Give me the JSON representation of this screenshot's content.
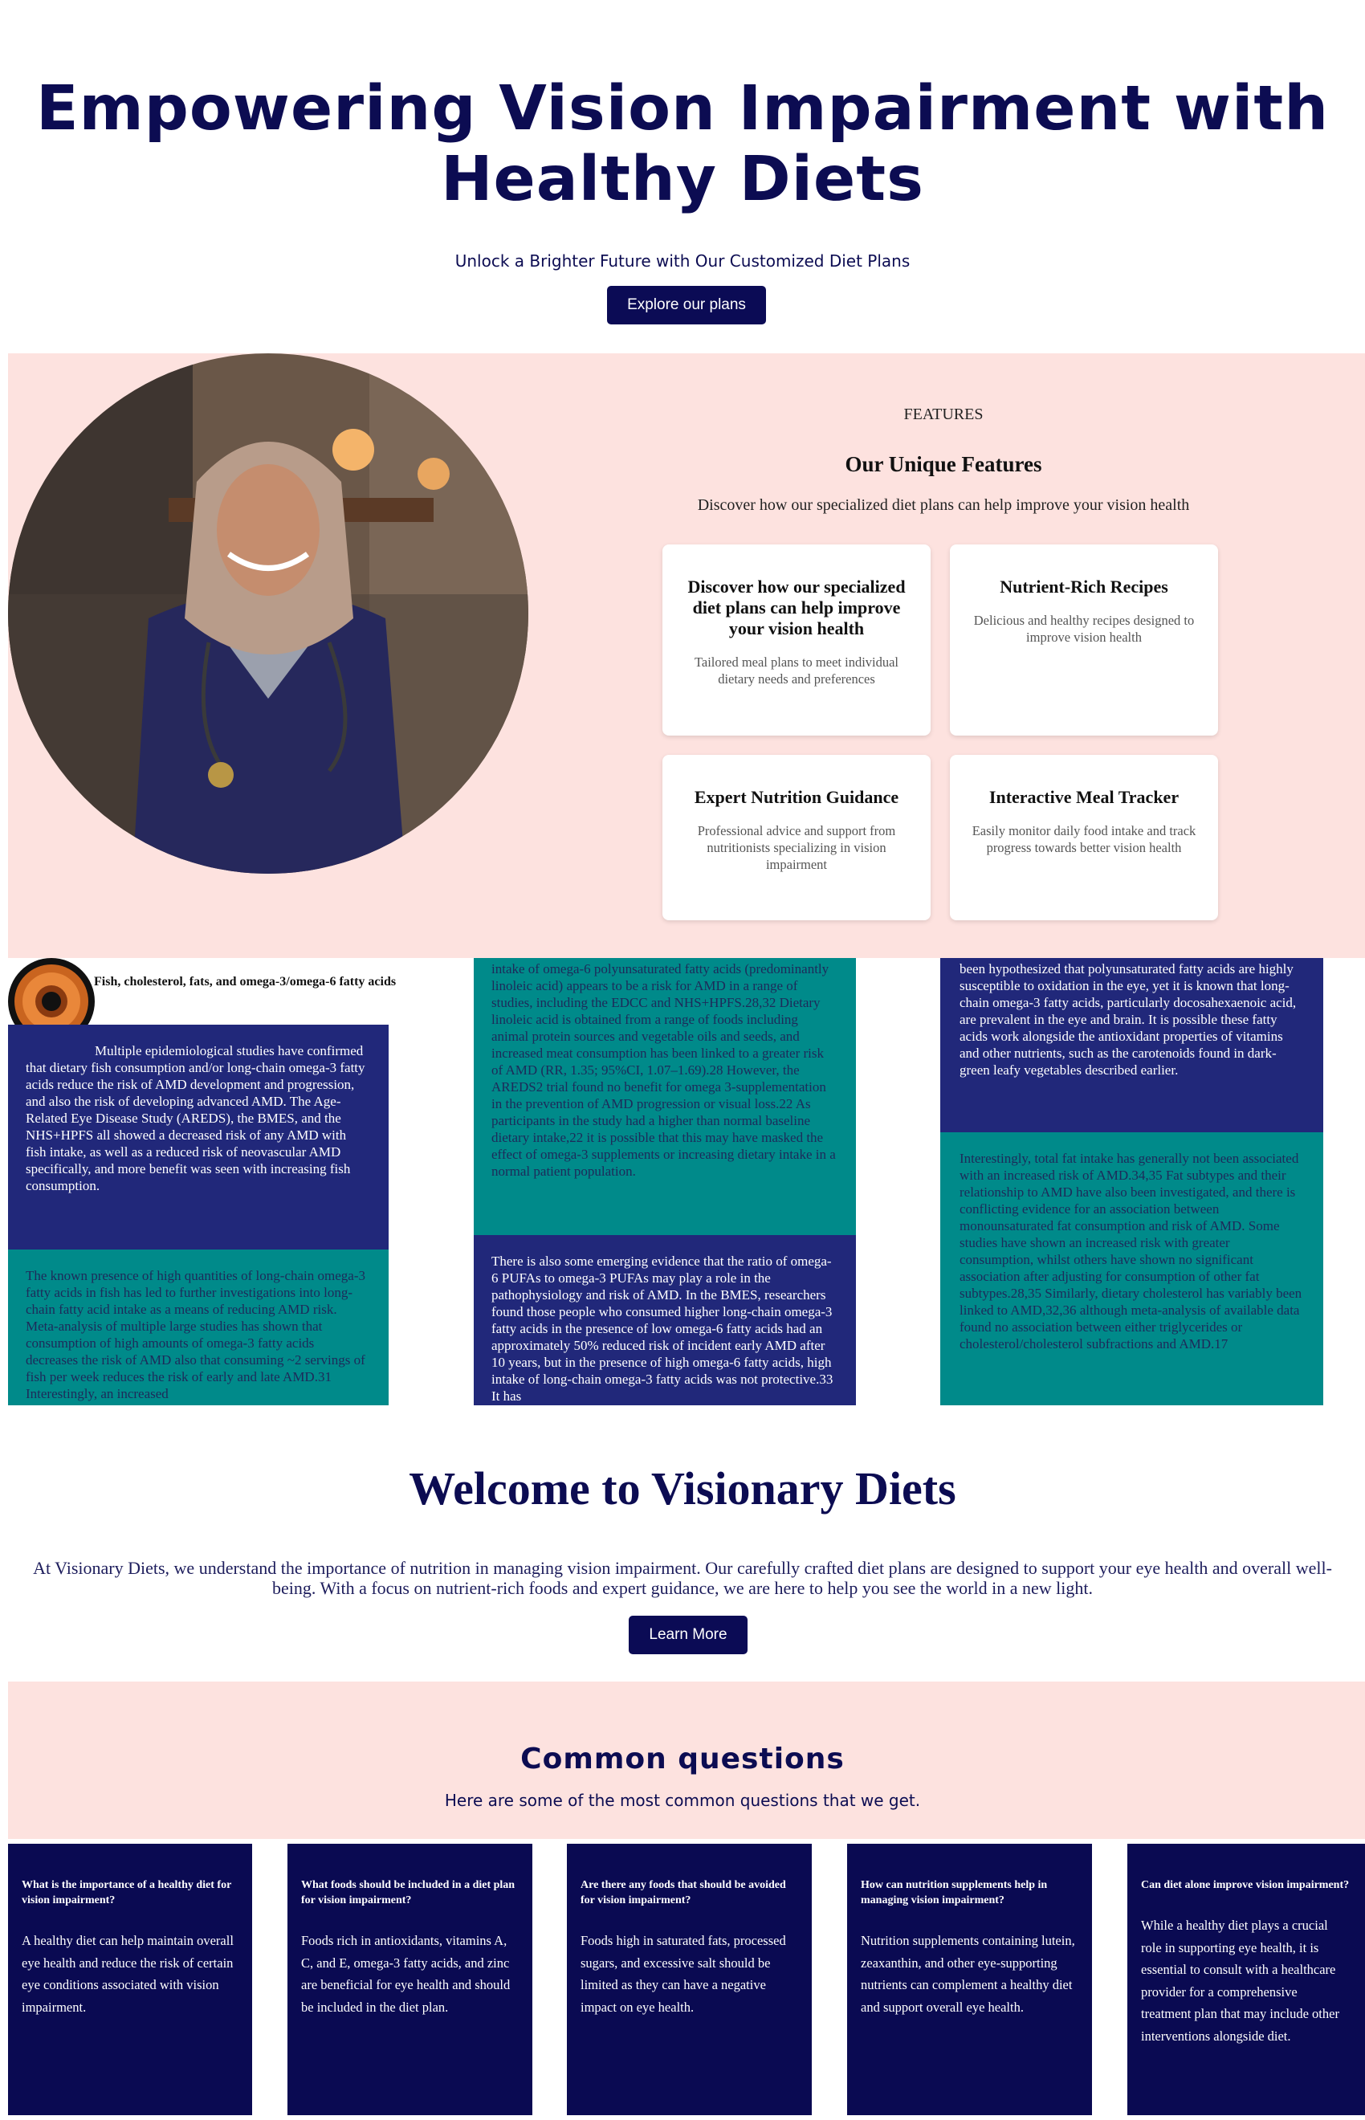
{
  "hero": {
    "title": "Empowering Vision Impairment with Healthy Diets",
    "subtitle": "Unlock a Brighter Future with Our Customized Diet Plans",
    "cta": "Explore our plans"
  },
  "features": {
    "label": "FEATURES",
    "title": "Our Unique Features",
    "description": "Discover how our specialized diet plans can help improve your vision health",
    "cards": [
      {
        "title": "Discover how our specialized diet plans can help improve your vision health",
        "text": "Tailored meal plans to meet individual dietary needs and preferences"
      },
      {
        "title": "Nutrient-Rich Recipes",
        "text": "Delicious and healthy recipes designed to improve vision health"
      },
      {
        "title": "Expert Nutrition Guidance",
        "text": "Professional advice and support from nutritionists specializing in vision impairment"
      },
      {
        "title": "Interactive Meal Tracker",
        "text": "Easily monitor daily food intake and track progress towards better vision health"
      }
    ]
  },
  "article": {
    "heading": "Fish, cholesterol, fats, and omega-3/omega-6 fatty acids",
    "col1": {
      "p1": "Multiple epidemiological studies have confirmed that dietary fish consumption and/or long-chain omega-3 fatty acids reduce the risk of AMD development and progression, and also the risk of developing advanced AMD. The Age-Related Eye Disease Study (AREDS), the BMES, and the NHS+HPFS all showed a decreased risk of any AMD with fish intake, as well as a reduced risk of neovascular AMD specifically, and more benefit was seen with increasing fish consumption.",
      "p2": "The known presence of high quantities of long-chain omega-3 fatty acids in fish has led to further investigations into long-chain fatty acid intake as a means of reducing AMD risk. Meta-analysis of multiple large studies has shown that consumption of high amounts of omega-3 fatty acids decreases the risk of AMD also that consuming ~2 servings of fish per week reduces the risk of early and late AMD.31 Interestingly, an increased"
    },
    "col2": {
      "p1": "intake of omega-6 polyunsaturated fatty acids (predominantly linoleic acid) appears to be a risk for AMD in a range of studies, including the EDCC and NHS+HPFS.28,32 Dietary linoleic acid is obtained from a range of foods including animal protein sources and vegetable oils and seeds, and increased meat consumption has been linked to a greater risk of AMD (RR, 1.35; 95%CI, 1.07–1.69).28 However, the AREDS2 trial found no benefit for omega 3-supplementation in the prevention of AMD progression or visual loss.22 As participants in the study had a higher than normal baseline dietary intake,22 it is possible that this may have masked the effect of omega-3 supplements or increasing dietary intake in a normal patient population.",
      "p2": "There is also some emerging evidence that the ratio of omega-6 PUFAs to omega-3 PUFAs may play a role in the pathophysiology and risk of AMD. In the BMES, researchers found those people who consumed higher long-chain omega-3 fatty acids in the presence of low omega-6 fatty acids had an approximately 50% reduced risk of incident early AMD after 10 years, but in the presence of high omega-6 fatty acids, high intake of long-chain omega-3 fatty acids was not protective.33 It has"
    },
    "col3": {
      "p1": "been hypothesized that polyunsaturated fatty acids are highly susceptible to oxidation in the eye, yet it is known that long-chain omega-3 fatty acids, particularly docosahexaenoic acid, are prevalent in the eye and brain. It is possible these fatty acids work alongside the antioxidant properties of vitamins and other nutrients, such as the carotenoids found in dark-green leafy vegetables described earlier.",
      "p2": "Interestingly, total fat intake has generally not been associated with an increased risk of AMD.34,35 Fat subtypes and their relationship to AMD have also been investigated, and there is conflicting evidence for an association between monounsaturated fat consumption and risk of AMD. Some studies have shown an increased risk with greater consumption, whilst others have shown no significant association after adjusting for consumption of other fat subtypes.28,35 Similarly, dietary cholesterol has variably been linked to AMD,32,36 although meta-analysis of available data found no association between either triglycerides or cholesterol/cholesterol subfractions and AMD.17"
    }
  },
  "welcome": {
    "title": "Welcome to Visionary Diets",
    "text": "At Visionary Diets, we understand the importance of nutrition in managing vision impairment. Our carefully crafted diet plans are designed to support your eye health and overall well-being. With a focus on nutrient-rich foods and expert guidance, we are here to help you see the world in a new light.",
    "cta": "Learn More"
  },
  "faq": {
    "title": "Common questions",
    "subtitle": "Here are some of the most common questions that we get.",
    "items": [
      {
        "q": "What is the importance of a healthy diet for vision impairment?",
        "a": "A healthy diet can help maintain overall eye health and reduce the risk of certain eye conditions associated with vision impairment."
      },
      {
        "q": "What foods should be included in a diet plan for vision impairment?",
        "a": "Foods rich in antioxidants, vitamins A, C, and E, omega-3 fatty acids, and zinc are beneficial for eye health and should be included in the diet plan."
      },
      {
        "q": "Are there any foods that should be avoided for vision impairment?",
        "a": "Foods high in saturated fats, processed sugars, and excessive salt should be limited as they can have a negative impact on eye health."
      },
      {
        "q": "How can nutrition supplements help in managing vision impairment?",
        "a": "Nutrition supplements containing lutein, zeaxanthin, and other eye-supporting nutrients can complement a healthy diet and support overall eye health."
      },
      {
        "q": "Can diet alone improve vision impairment?",
        "a": "While a healthy diet plays a crucial role in supporting eye health, it is essential to consult with a healthcare provider for a comprehensive treatment plan that may include other interventions alongside diet."
      }
    ]
  },
  "colors": {
    "navy": "#0b0b55",
    "pink": "#fde2df",
    "teal": "#008a8a",
    "article_navy": "#21287a"
  },
  "images": {
    "hero_photo": "smiling-nurse-photo",
    "eye_icon": "eye-iris-icon"
  }
}
